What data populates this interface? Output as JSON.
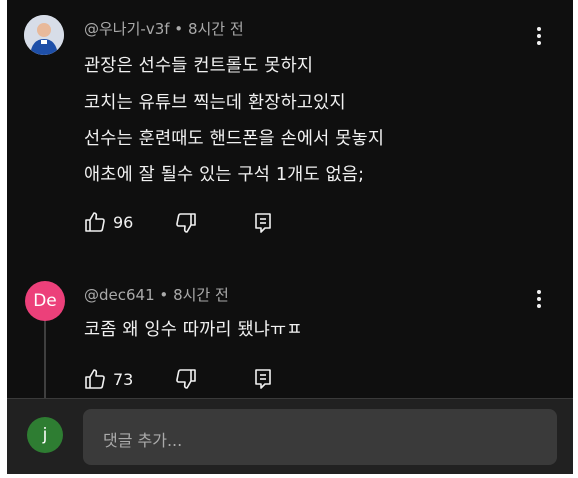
{
  "comments": [
    {
      "author": "@우나기-v3f",
      "separator": "•",
      "time": "8시간 전",
      "lines": [
        "관장은 선수들 컨트롤도 못하지",
        "코치는 유튜브 찍는데 환장하고있지",
        "선수는 훈련때도 핸드폰을 손에서 못놓지",
        "애초에 잘 될수 있는 구석 1개도 없음;"
      ],
      "likes": "96"
    },
    {
      "avatar_text": "De",
      "author": "@dec641",
      "separator": "•",
      "time": "8시간 전",
      "lines": [
        "코좀 왜 잉수 따까리 됐냐ㅠㅍ"
      ],
      "likes": "73"
    }
  ],
  "footer": {
    "avatar_text": "j",
    "placeholder": "댓글 추가..."
  },
  "colors": {
    "background": "#0f0f0f",
    "avatar_de": "#ec407a",
    "avatar_j": "#2e7d32"
  }
}
